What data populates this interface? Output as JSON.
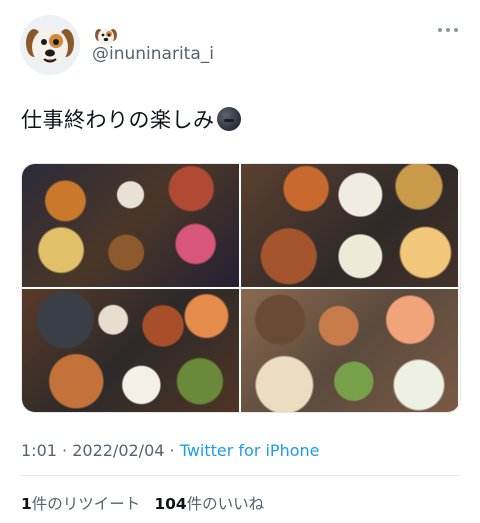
{
  "user": {
    "avatar_icon": "dog-face-icon",
    "name_icon": "dog-face-icon",
    "handle": "@inuninarita_i"
  },
  "tweet": {
    "text": "仕事終わりの楽しみ",
    "emoji_icon": "new-moon-face-icon"
  },
  "media": {
    "photos": [
      {
        "icon": "bento-boxes-photo"
      },
      {
        "icon": "food-plates-photo"
      },
      {
        "icon": "bento-trays-photo"
      },
      {
        "icon": "dishes-spread-photo"
      }
    ]
  },
  "meta": {
    "time": "1:01",
    "sep1": " · ",
    "date": "2022/02/04",
    "sep2": " · ",
    "source": "Twitter for iPhone"
  },
  "stats": {
    "retweet_count": "1",
    "retweet_label": "件のリツイート",
    "like_count": "104",
    "like_label": "件のいいね"
  },
  "colors": {
    "link": "#1d9bf0",
    "secondary_text": "#536471"
  }
}
